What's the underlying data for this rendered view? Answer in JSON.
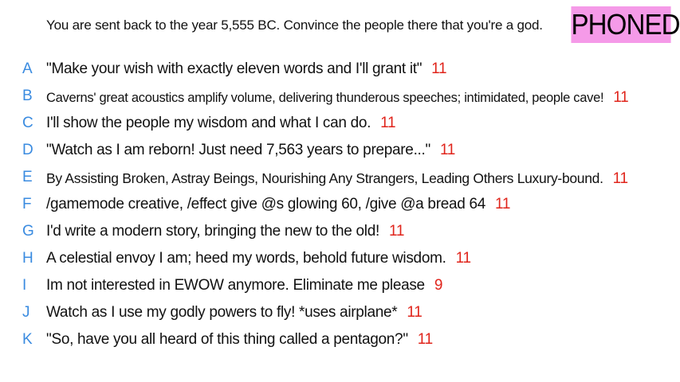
{
  "prompt": "You are sent back to the year 5,555 BC. Convince the people there that you're a god.",
  "badge": "PHONED",
  "colors": {
    "letter": "#3a8be0",
    "count": "#e0241b",
    "badge_bg": "#f59ae8"
  },
  "entries": [
    {
      "letter": "A",
      "text": "\"Make your wish with exactly eleven words and I'll grant it\"",
      "count": "11"
    },
    {
      "letter": "B",
      "text": "Caverns' great acoustics amplify volume, delivering thunderous speeches; intimidated, people cave!",
      "count": "11"
    },
    {
      "letter": "C",
      "text": "I'll show the people my wisdom and what I can do.",
      "count": "11"
    },
    {
      "letter": "D",
      "text": "\"Watch as I am reborn! Just need 7,563 years to prepare...\"",
      "count": "11"
    },
    {
      "letter": "E",
      "text": "By Assisting Broken, Astray Beings, Nourishing Any Strangers, Leading Others Luxury-bound.",
      "count": "11"
    },
    {
      "letter": "F",
      "text": "/gamemode creative, /effect give @s glowing 60, /give @a bread 64",
      "count": "11"
    },
    {
      "letter": "G",
      "text": "I'd write a modern story, bringing the new to the old!",
      "count": "11"
    },
    {
      "letter": "H",
      "text": "A celestial envoy I am; heed my words, behold future wisdom.",
      "count": "11"
    },
    {
      "letter": "I",
      "text": "Im not interested in EWOW anymore. Eliminate me please",
      "count": "9"
    },
    {
      "letter": "J",
      "text": "Watch as I use my godly powers to fly!  *uses airplane*",
      "count": "11"
    },
    {
      "letter": "K",
      "text": "\"So, have you all heard of this thing called a pentagon?\"",
      "count": "11"
    }
  ]
}
